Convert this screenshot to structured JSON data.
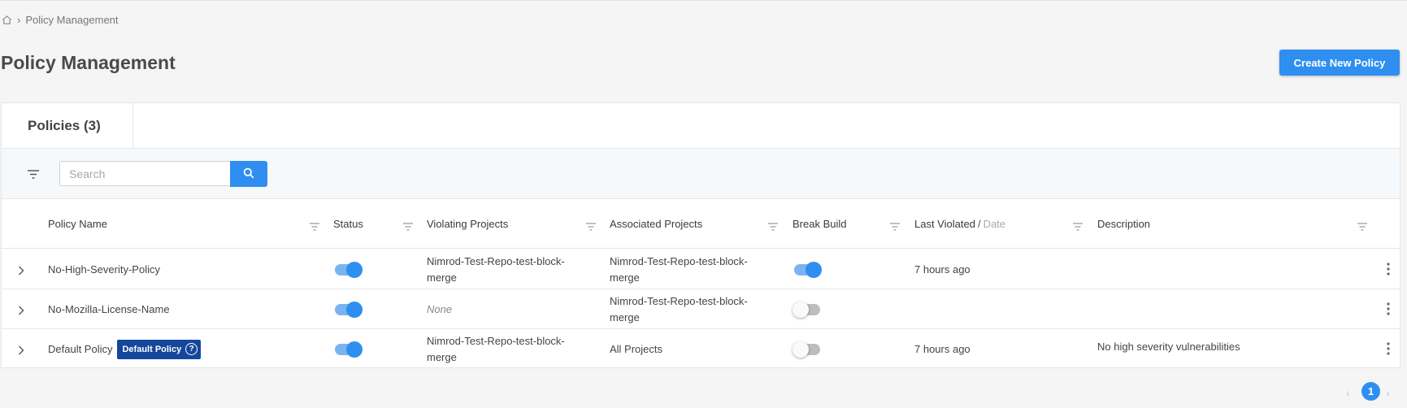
{
  "breadcrumb": {
    "home_icon": "home-icon",
    "separator": "›",
    "current": "Policy Management"
  },
  "page": {
    "title": "Policy Management",
    "create_button": "Create New Policy"
  },
  "tabs": [
    {
      "label": "Policies (3)"
    }
  ],
  "search": {
    "placeholder": "Search",
    "value": ""
  },
  "columns": {
    "name": "Policy Name",
    "status": "Status",
    "violating": "Violating Projects",
    "associated": "Associated Projects",
    "break_build": "Break Build",
    "last_violated": "Last Violated",
    "last_violated_sep": "/",
    "last_violated_alt": "Date",
    "description": "Description"
  },
  "rows": [
    {
      "name": "No-High-Severity-Policy",
      "badge": "",
      "status": true,
      "violating": "Nimrod-Test-Repo-test-block-merge",
      "associated": "Nimrod-Test-Repo-test-block-merge",
      "break_build": true,
      "last_violated": "7 hours ago",
      "description": ""
    },
    {
      "name": "No-Mozilla-License-Name",
      "badge": "",
      "status": true,
      "violating": "None",
      "associated": "Nimrod-Test-Repo-test-block-merge",
      "break_build": false,
      "last_violated": "",
      "description": ""
    },
    {
      "name": "Default Policy",
      "badge": "Default Policy",
      "status": true,
      "violating": "Nimrod-Test-Repo-test-block-merge",
      "associated": "All Projects",
      "break_build": false,
      "last_violated": "7 hours ago",
      "description": "No high severity vulnerabilities"
    }
  ],
  "pagination": {
    "prev": "‹",
    "current": "1",
    "next": "›"
  },
  "colors": {
    "accent": "#2f8ff0",
    "badge": "#14479b",
    "toggle_track_on": "#7ab4f0"
  }
}
